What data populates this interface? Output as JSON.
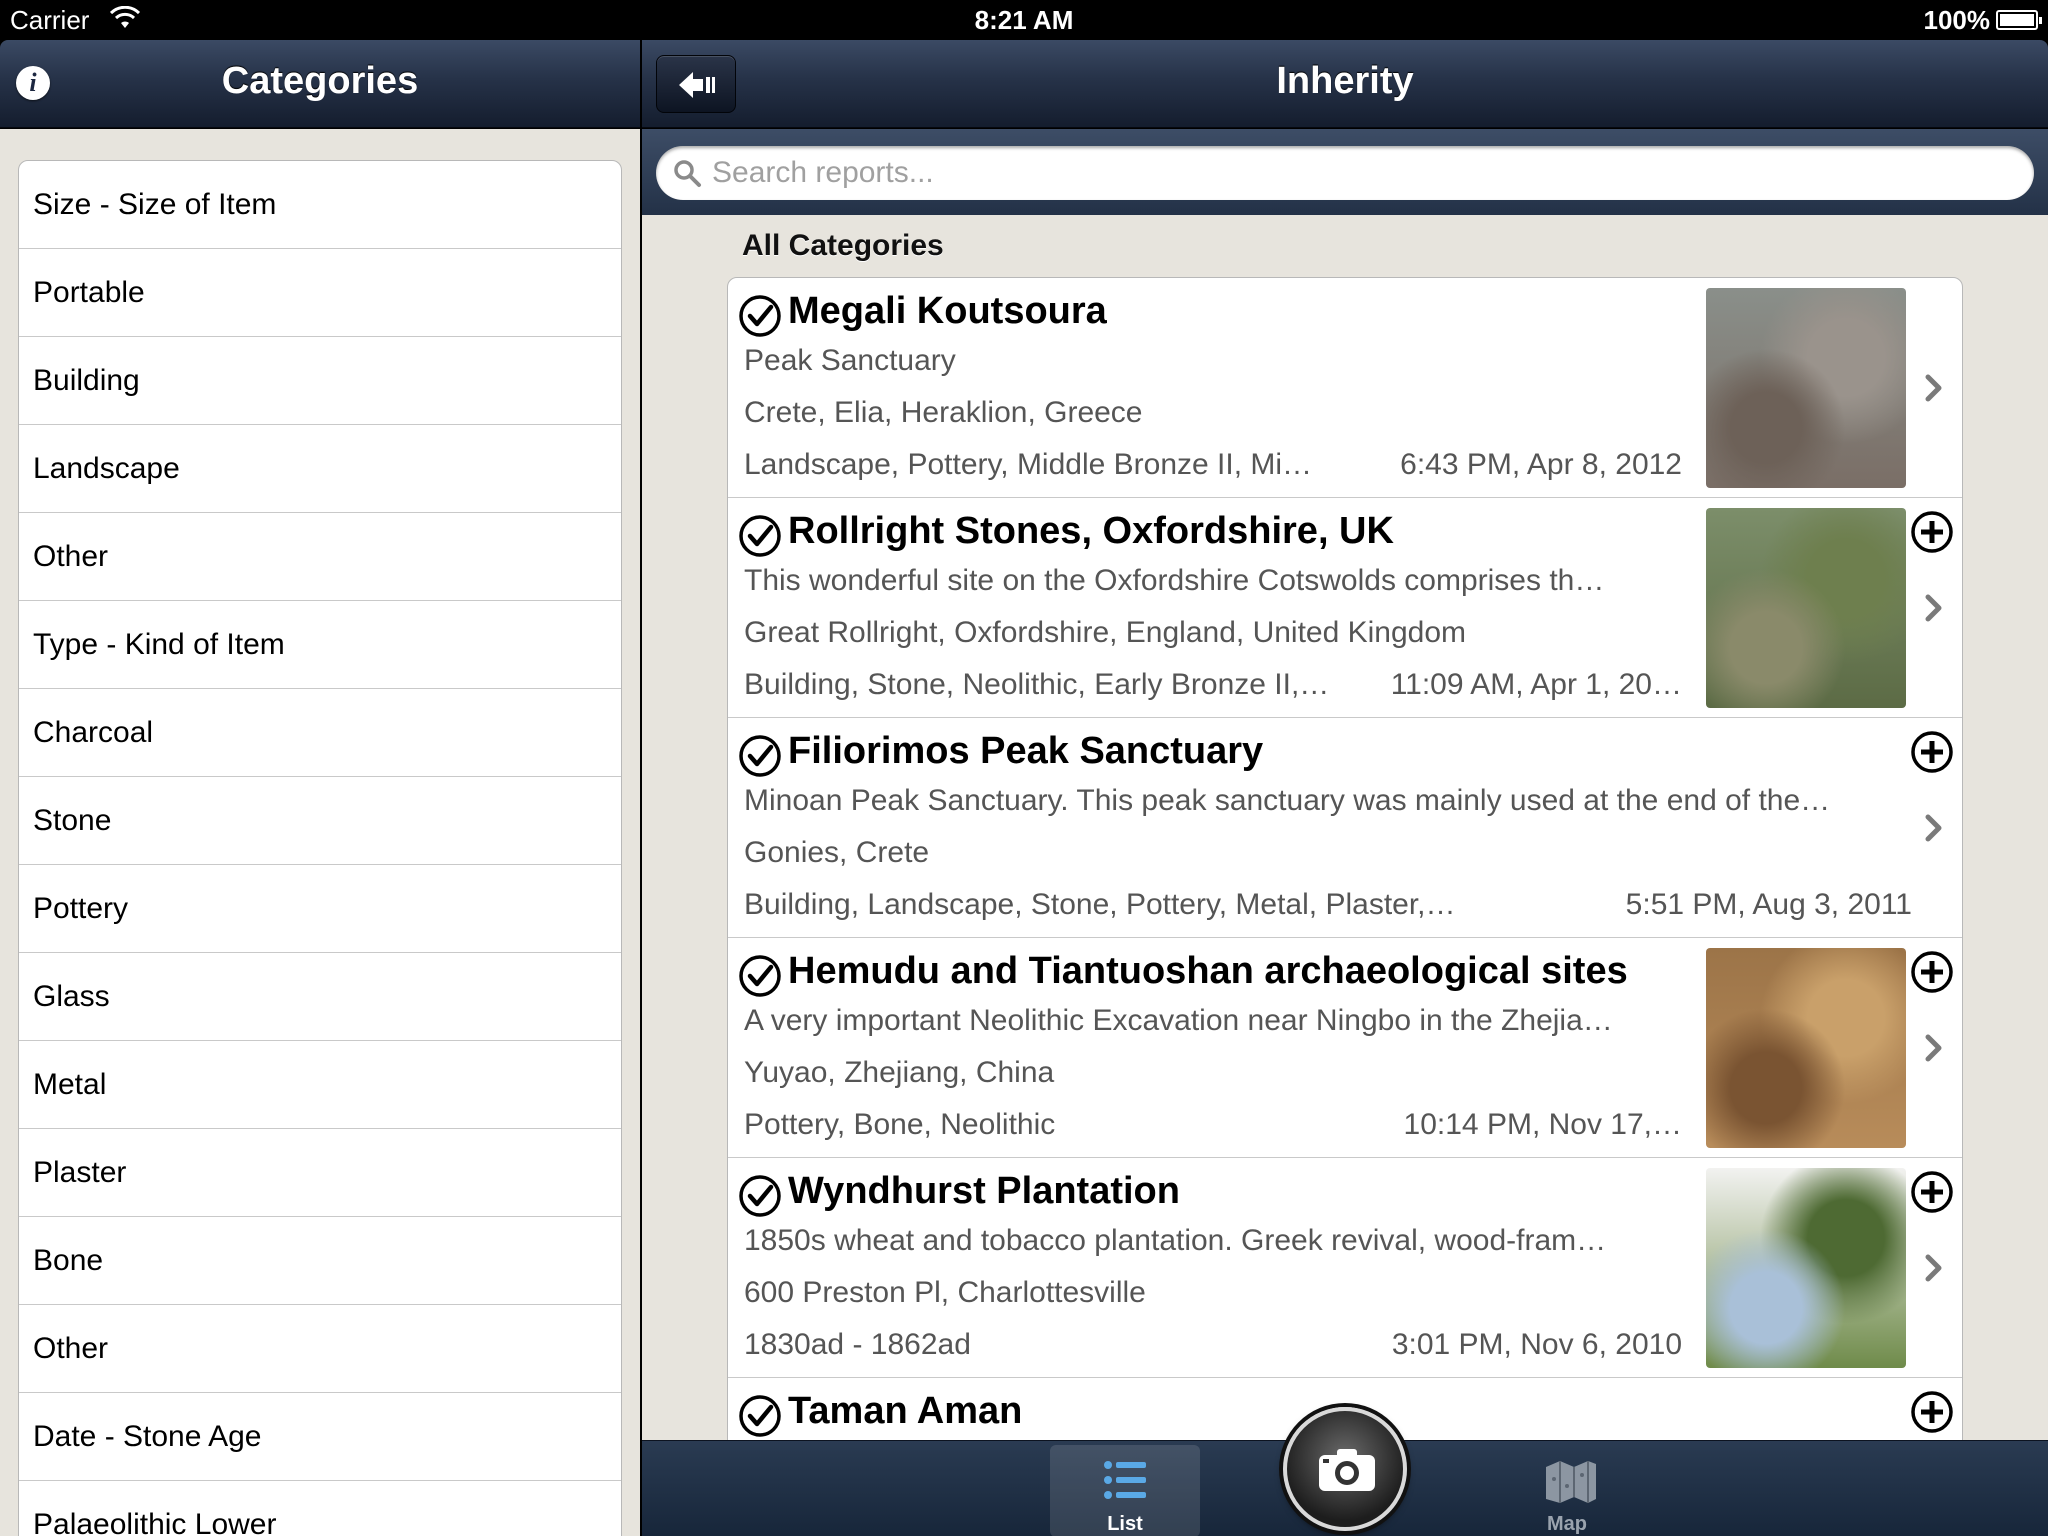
{
  "status_bar": {
    "carrier": "Carrier",
    "time": "8:21 AM",
    "battery": "100%"
  },
  "left_nav": {
    "title": "Categories",
    "info_label": "i"
  },
  "right_nav": {
    "title": "Inherity"
  },
  "categories": [
    "Size - Size of Item",
    "Portable",
    "Building",
    "Landscape",
    "Other",
    "Type - Kind of Item",
    "Charcoal",
    "Stone",
    "Pottery",
    "Glass",
    "Metal",
    "Plaster",
    "Bone",
    "Other",
    "Date - Stone Age",
    "Palaeolithic Lower"
  ],
  "search": {
    "placeholder": "Search reports..."
  },
  "section_header": "All Categories",
  "reports": [
    {
      "title": "Megali Koutsoura",
      "line1": "Peak Sanctuary",
      "line2": "Crete, Elia, Heraklion, Greece",
      "tags": "Landscape, Pottery, Middle Bronze II, Mi…",
      "date": "6:43 PM, Apr 8, 2012",
      "has_thumb": true,
      "has_plus": false,
      "thumb_colors": [
        "#8a8f8a",
        "#7a6e66",
        "#6d6158",
        "#9a938c"
      ]
    },
    {
      "title": "Rollright Stones, Oxfordshire, UK",
      "line1": "This wonderful site on the Oxfordshire Cotswolds comprises th…",
      "line2": "Great Rollright, Oxfordshire, England, United Kingdom",
      "tags": "Building, Stone, Neolithic, Early Bronze II,…",
      "date": "11:09 AM, Apr 1, 20…",
      "has_thumb": true,
      "has_plus": true,
      "thumb_colors": [
        "#7c8e6a",
        "#5c6b45",
        "#8a8a6a",
        "#6e7f4e"
      ]
    },
    {
      "title": "Filiorimos Peak Sanctuary",
      "line1": "Minoan Peak Sanctuary. This peak sanctuary was mainly used at the end of the…",
      "line2": "Gonies, Crete",
      "tags": "Building, Landscape, Stone, Pottery, Metal, Plaster,…",
      "date": "5:51 PM, Aug 3, 2011",
      "has_thumb": false,
      "has_plus": true,
      "thumb_colors": []
    },
    {
      "title": "Hemudu and Tiantuoshan archaeological sites",
      "line1": "A very important Neolithic Excavation near Ningbo in the Zhejia…",
      "line2": "Yuyao, Zhejiang, China",
      "tags": "Pottery, Bone, Neolithic",
      "date": "10:14 PM, Nov 17,…",
      "has_thumb": true,
      "has_plus": true,
      "thumb_colors": [
        "#9c7448",
        "#b88c5a",
        "#7a5432",
        "#c9a06a"
      ]
    },
    {
      "title": "Wyndhurst Plantation",
      "line1": "1850s wheat and tobacco plantation.  Greek revival, wood-fram…",
      "line2": "600 Preston Pl, Charlottesville",
      "tags": "1830ad - 1862ad",
      "date": "3:01 PM, Nov 6, 2010",
      "has_thumb": true,
      "has_plus": true,
      "thumb_colors": [
        "#f2f2f0",
        "#6f8b4a",
        "#a9c0d8",
        "#4e6a33"
      ]
    },
    {
      "title": "Taman Aman",
      "line1": "",
      "line2": "",
      "tags": "",
      "date": "",
      "has_thumb": false,
      "has_plus": true,
      "thumb_colors": []
    }
  ],
  "tabs": {
    "list_label": "List",
    "map_label": "Map"
  },
  "colors": {
    "navbar": "#263248",
    "background": "#e7e4dd",
    "tabbar": "#1f2f45"
  }
}
